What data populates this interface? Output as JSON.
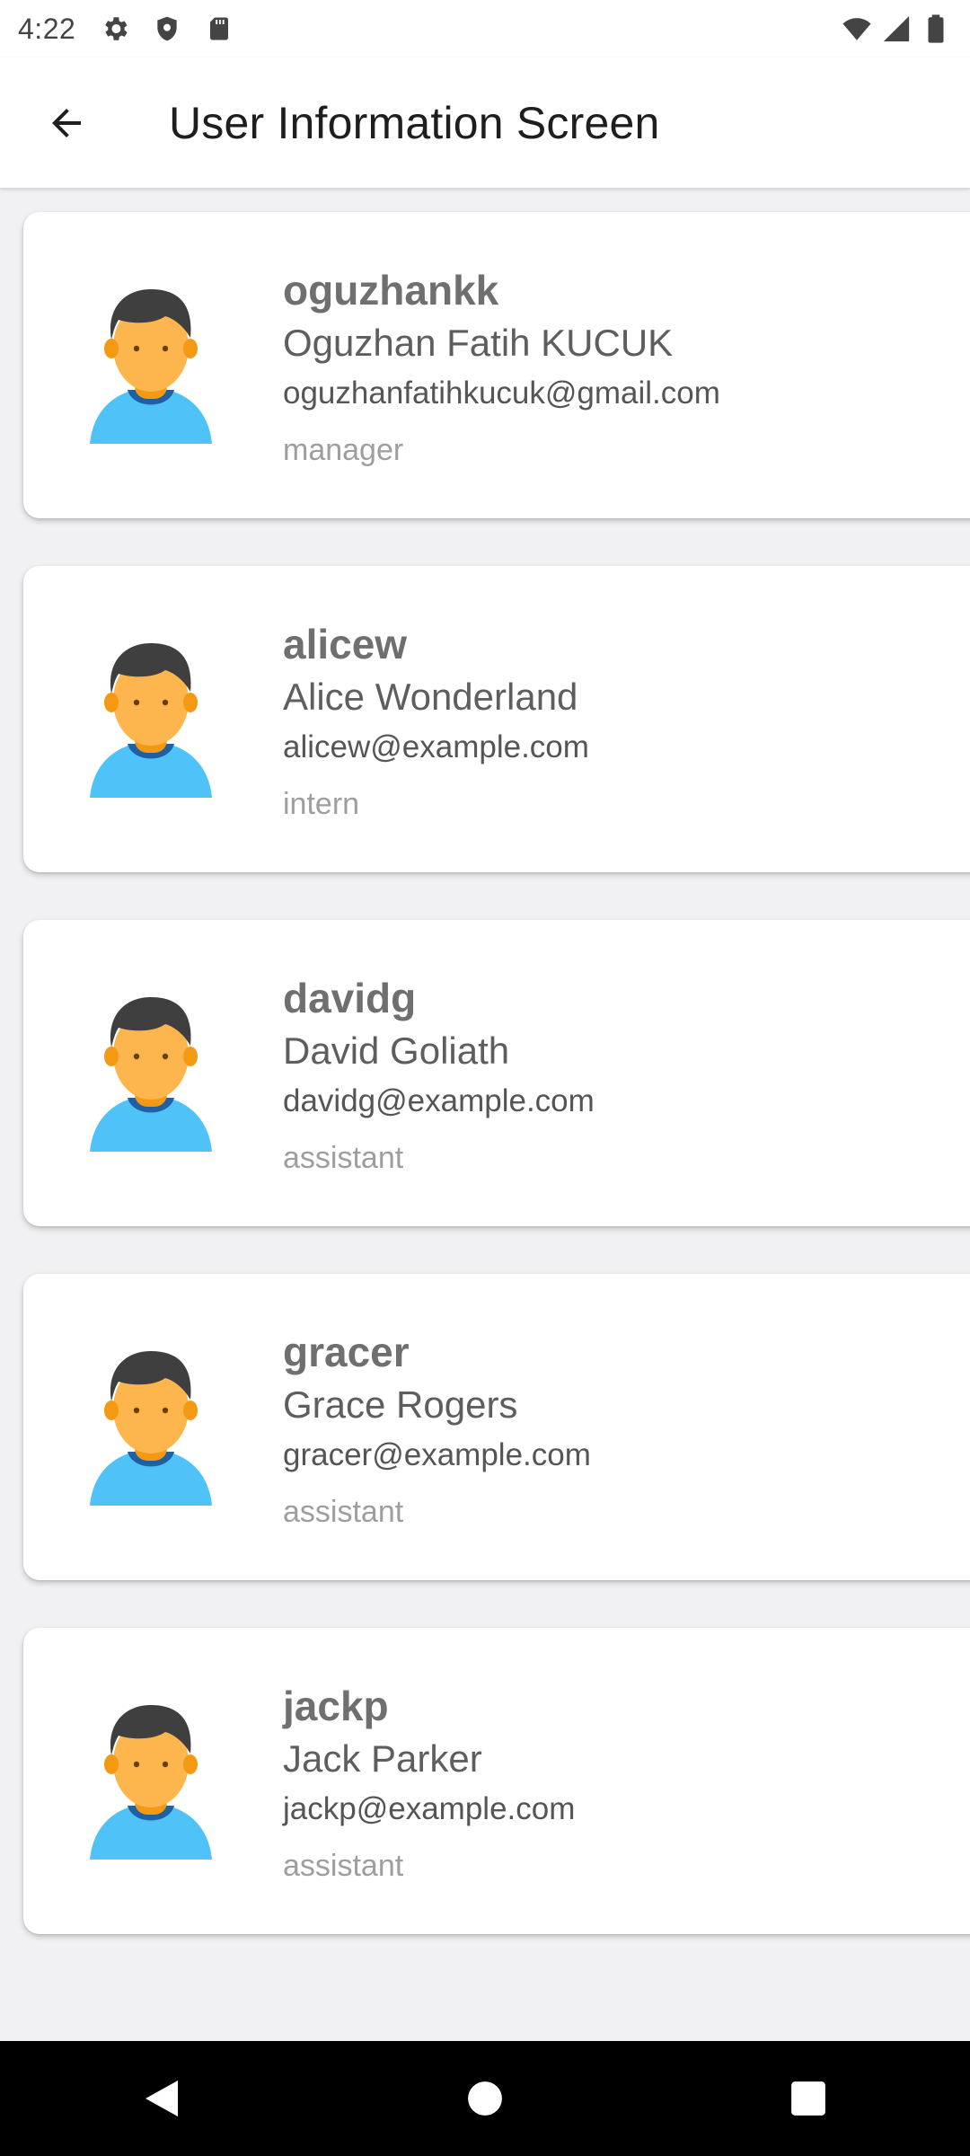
{
  "status_bar": {
    "time": "4:22",
    "left_icons": [
      "gear-icon",
      "shield-icon",
      "sd-card-icon"
    ],
    "right_icons": [
      "wifi-icon",
      "signal-icon",
      "battery-icon"
    ]
  },
  "app_bar": {
    "title": "User Information Screen",
    "back_icon": "arrow-back-icon"
  },
  "users": [
    {
      "username": "oguzhankk",
      "full_name": "Oguzhan Fatih KUCUK",
      "email": "oguzhanfatihkucuk@gmail.com",
      "role": "manager"
    },
    {
      "username": "alicew",
      "full_name": "Alice Wonderland",
      "email": "alicew@example.com",
      "role": "intern"
    },
    {
      "username": "davidg",
      "full_name": "David Goliath",
      "email": "davidg@example.com",
      "role": "assistant"
    },
    {
      "username": "gracer",
      "full_name": "Grace Rogers",
      "email": "gracer@example.com",
      "role": "assistant"
    },
    {
      "username": "jackp",
      "full_name": "Jack Parker",
      "email": "jackp@example.com",
      "role": "assistant"
    }
  ],
  "nav_bar": {
    "buttons": [
      "back-triangle-icon",
      "home-circle-icon",
      "recents-square-icon"
    ]
  },
  "colors": {
    "avatar_skin": "#FDB54E",
    "avatar_hair": "#3F3F3F",
    "avatar_shirt": "#4FC3F7",
    "avatar_collar": "#1F5FA6",
    "background": "#F1F1F3"
  }
}
